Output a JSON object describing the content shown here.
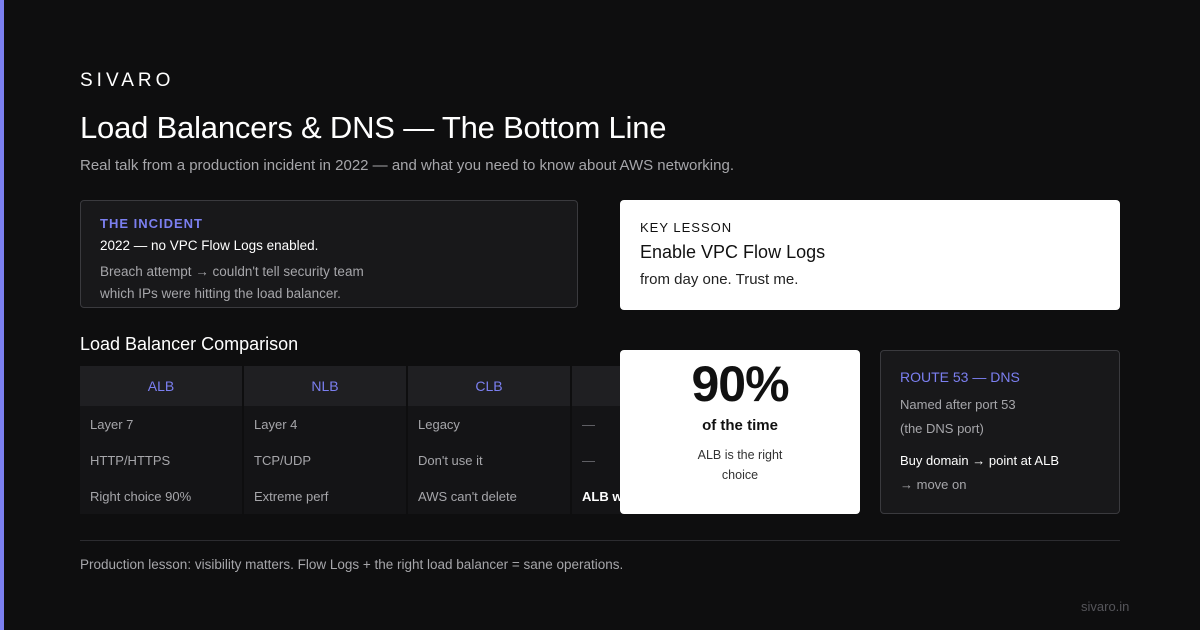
{
  "brand": "SIVARO",
  "title": "Load Balancers & DNS — The Bottom Line",
  "subtitle": "Real talk from a production incident in 2022 — and what you need to know about AWS networking.",
  "incident": {
    "label": "THE INCIDENT",
    "line1": "2022 — no VPC Flow Logs enabled.",
    "line2": "Breach attempt → couldn't tell security team which IPs were hitting the load balancer."
  },
  "key_lesson": {
    "label": "KEY LESSON",
    "headline": "Enable VPC Flow Logs",
    "body": "from day one. Trust me."
  },
  "comparison": {
    "title": "Load Balancer Comparison",
    "headers": [
      "ALB",
      "NLB",
      "CLB",
      ""
    ],
    "rows": [
      [
        "Layer 7",
        "Layer 4",
        "Legacy",
        "—"
      ],
      [
        "HTTP/HTTPS",
        "TCP/UDP",
        "Don't use it",
        "—"
      ],
      [
        "Right choice 90%",
        "Extreme perf",
        "AWS can't delete",
        "ALB wins"
      ]
    ]
  },
  "stat": {
    "value": "90%",
    "caption": "of the time",
    "description": "ALB is the right choice"
  },
  "route53": {
    "label": "ROUTE 53 — DNS",
    "line1": "Named after port 53",
    "line2": "(the DNS port)",
    "action": "Buy domain → point at ALB",
    "action_rest": "→ move on"
  },
  "footer": "Production lesson: visibility matters. Flow Logs + the right load balancer = sane operations.",
  "site": "sivaro.in",
  "colors": {
    "accent": "#7b7ff0",
    "background": "#0e0e0f",
    "card_light": "#ffffff",
    "card_dark": "#18181a"
  }
}
